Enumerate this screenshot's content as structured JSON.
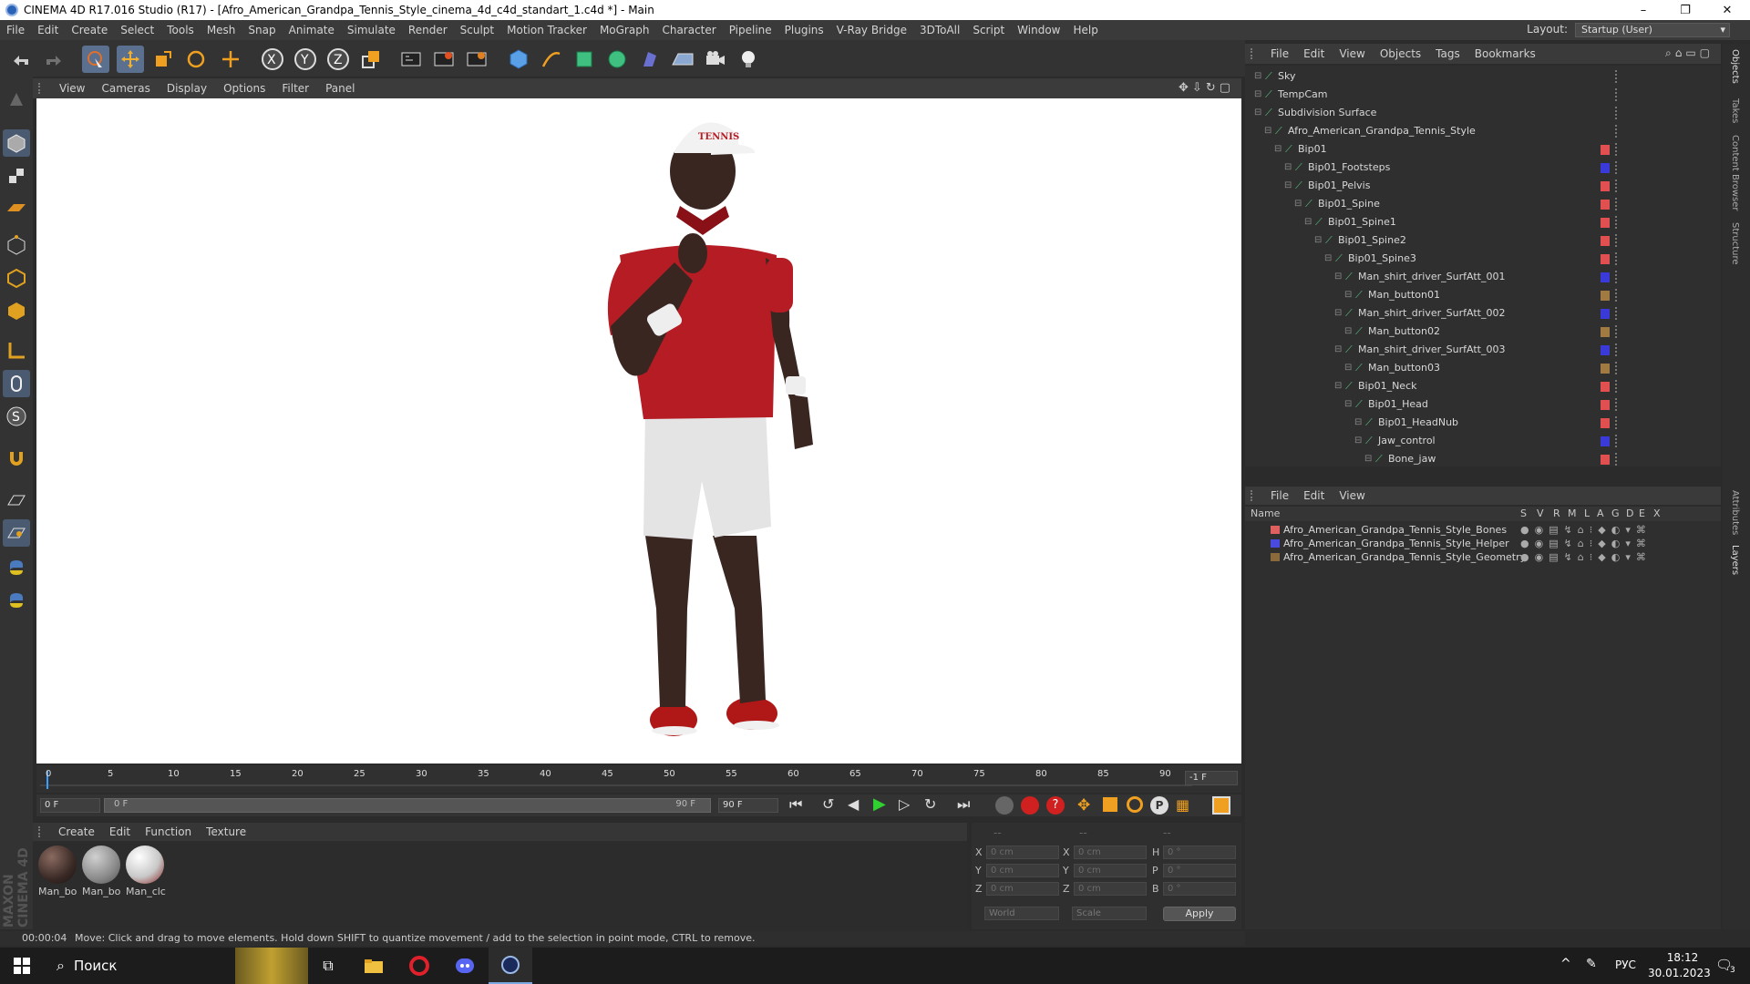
{
  "window": {
    "title": "CINEMA 4D R17.016 Studio (R17) - [Afro_American_Grandpa_Tennis_Style_cinema_4d_c4d_standart_1.c4d *] - Main",
    "minimize": "–",
    "maximize": "❐",
    "close": "✕"
  },
  "menubar": {
    "items": [
      "File",
      "Edit",
      "Create",
      "Select",
      "Tools",
      "Mesh",
      "Snap",
      "Animate",
      "Simulate",
      "Render",
      "Sculpt",
      "Motion Tracker",
      "MoGraph",
      "Character",
      "Pipeline",
      "Plugins",
      "V-Ray Bridge",
      "3DToAll",
      "Script",
      "Window",
      "Help"
    ],
    "layout_label": "Layout:",
    "layout_value": "Startup (User)"
  },
  "viewport": {
    "menu": [
      "View",
      "Cameras",
      "Display",
      "Options",
      "Filter",
      "Panel"
    ]
  },
  "timeline": {
    "ticks": [
      "0",
      "5",
      "10",
      "15",
      "20",
      "25",
      "30",
      "35",
      "40",
      "45",
      "50",
      "55",
      "60",
      "65",
      "70",
      "75",
      "80",
      "85",
      "90"
    ],
    "current_frame": "-1 F",
    "start_field": "0 F",
    "range_start": "0 F",
    "range_end": "90 F",
    "end_field": "90 F"
  },
  "materials": {
    "menu": [
      "Create",
      "Edit",
      "Function",
      "Texture"
    ],
    "items": [
      {
        "label": "Man_bo",
        "color": "#3a2a26"
      },
      {
        "label": "Man_bo",
        "color": "#8a8a8a"
      },
      {
        "label": "Man_clc",
        "color": "#c8c8c8"
      }
    ]
  },
  "coordinates": {
    "header": [
      "--",
      "--",
      "--"
    ],
    "rows": [
      {
        "a": "X",
        "av": "0 cm",
        "b": "X",
        "bv": "0 cm",
        "c": "H",
        "cv": "0 °"
      },
      {
        "a": "Y",
        "av": "0 cm",
        "b": "Y",
        "bv": "0 cm",
        "c": "P",
        "cv": "0 °"
      },
      {
        "a": "Z",
        "av": "0 cm",
        "b": "Z",
        "bv": "0 cm",
        "c": "B",
        "cv": "0 °"
      }
    ],
    "space": "World",
    "mode": "Scale",
    "apply": "Apply"
  },
  "status": {
    "time": "00:00:04",
    "message": "Move: Click and drag to move elements. Hold down SHIFT to quantize movement / add to the selection in point mode, CTRL to remove."
  },
  "objects": {
    "menu": [
      "File",
      "Edit",
      "View",
      "Objects",
      "Tags",
      "Bookmarks"
    ],
    "rows": [
      {
        "name": "Sky",
        "indent": 0,
        "color": "#2f2f2f"
      },
      {
        "name": "TempCam",
        "indent": 0,
        "color": "#2f2f2f"
      },
      {
        "name": "Subdivision Surface",
        "indent": 0,
        "color": "#2f2f2f"
      },
      {
        "name": "Afro_American_Grandpa_Tennis_Style",
        "indent": 1,
        "color": "#2f2f2f"
      },
      {
        "name": "Bip01",
        "indent": 2,
        "color": "#e05050"
      },
      {
        "name": "Bip01_Footsteps",
        "indent": 3,
        "color": "#3a3ad8"
      },
      {
        "name": "Bip01_Pelvis",
        "indent": 3,
        "color": "#e05050"
      },
      {
        "name": "Bip01_Spine",
        "indent": 4,
        "color": "#e05050"
      },
      {
        "name": "Bip01_Spine1",
        "indent": 5,
        "color": "#e05050"
      },
      {
        "name": "Bip01_Spine2",
        "indent": 6,
        "color": "#e05050"
      },
      {
        "name": "Bip01_Spine3",
        "indent": 7,
        "color": "#e05050"
      },
      {
        "name": "Man_shirt_driver_SurfAtt_001",
        "indent": 8,
        "color": "#3a3ad8"
      },
      {
        "name": "Man_button01",
        "indent": 9,
        "color": "#a07a40"
      },
      {
        "name": "Man_shirt_driver_SurfAtt_002",
        "indent": 8,
        "color": "#3a3ad8"
      },
      {
        "name": "Man_button02",
        "indent": 9,
        "color": "#a07a40"
      },
      {
        "name": "Man_shirt_driver_SurfAtt_003",
        "indent": 8,
        "color": "#3a3ad8"
      },
      {
        "name": "Man_button03",
        "indent": 9,
        "color": "#a07a40"
      },
      {
        "name": "Bip01_Neck",
        "indent": 8,
        "color": "#e05050"
      },
      {
        "name": "Bip01_Head",
        "indent": 9,
        "color": "#e05050"
      },
      {
        "name": "Bip01_HeadNub",
        "indent": 10,
        "color": "#e05050"
      },
      {
        "name": "Jaw_control",
        "indent": 10,
        "color": "#3a3ad8"
      },
      {
        "name": "Bone_jaw",
        "indent": 11,
        "color": "#e05050"
      }
    ]
  },
  "layers": {
    "menu": [
      "File",
      "Edit",
      "View"
    ],
    "header_name": "Name",
    "header_cols": [
      "S",
      "V",
      "R",
      "M",
      "L",
      "A",
      "G",
      "D",
      "E",
      "X"
    ],
    "rows": [
      {
        "name": "Afro_American_Grandpa_Tennis_Style_Bones",
        "color": "#e06060"
      },
      {
        "name": "Afro_American_Grandpa_Tennis_Style_Helper",
        "color": "#4a4ae0"
      },
      {
        "name": "Afro_American_Grandpa_Tennis_Style_Geometry",
        "color": "#8a6a3a"
      }
    ]
  },
  "side_tabs": [
    "Objects",
    "Takes",
    "Content Browser",
    "Structure",
    "Attributes",
    "Layers"
  ],
  "brand": "MAXON CINEMA 4D",
  "taskbar": {
    "search": "Поиск",
    "lang": "РУС",
    "time": "18:12",
    "date": "30.01.2023",
    "notif": "3"
  }
}
